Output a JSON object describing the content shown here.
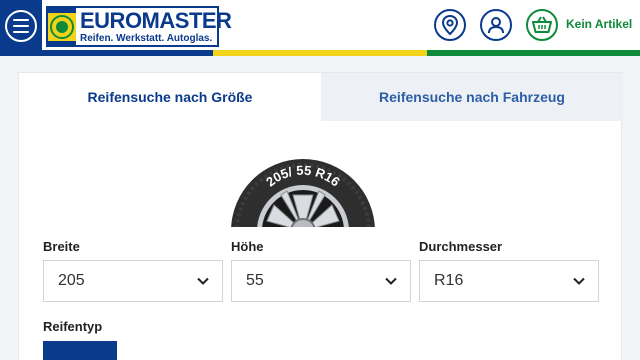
{
  "header": {
    "logo": {
      "name": "EUROMASTER",
      "tagline": "Reifen. Werkstatt. Autoglas."
    },
    "icons": [
      "menu-icon",
      "location-pin-icon",
      "user-icon",
      "basket-icon"
    ],
    "cart_label": "Kein Artikel",
    "stripe_colors": [
      "#0a3a8c",
      "#f3d21a",
      "#0e8b3a"
    ]
  },
  "tabs": [
    {
      "label": "Reifensuche nach Größe",
      "active": true
    },
    {
      "label": "Reifensuche nach Fahrzeug",
      "active": false
    }
  ],
  "tire": {
    "size_text": "205/ 55 R16"
  },
  "fields": {
    "breite": {
      "label": "Breite",
      "value": "205"
    },
    "hoehe": {
      "label": "Höhe",
      "value": "55"
    },
    "durchmesser": {
      "label": "Durchmesser",
      "value": "R16"
    }
  },
  "reifentyp": {
    "label": "Reifentyp",
    "options": [
      {
        "icon": "sun-icon",
        "active": true
      },
      {
        "icon": "all-season-icon",
        "active": false
      },
      {
        "icon": "snowflake-icon",
        "active": false
      }
    ]
  },
  "colors": {
    "primary": "#0a3a8c",
    "accent_green": "#0e8b3a",
    "accent_yellow": "#f3d21a"
  }
}
